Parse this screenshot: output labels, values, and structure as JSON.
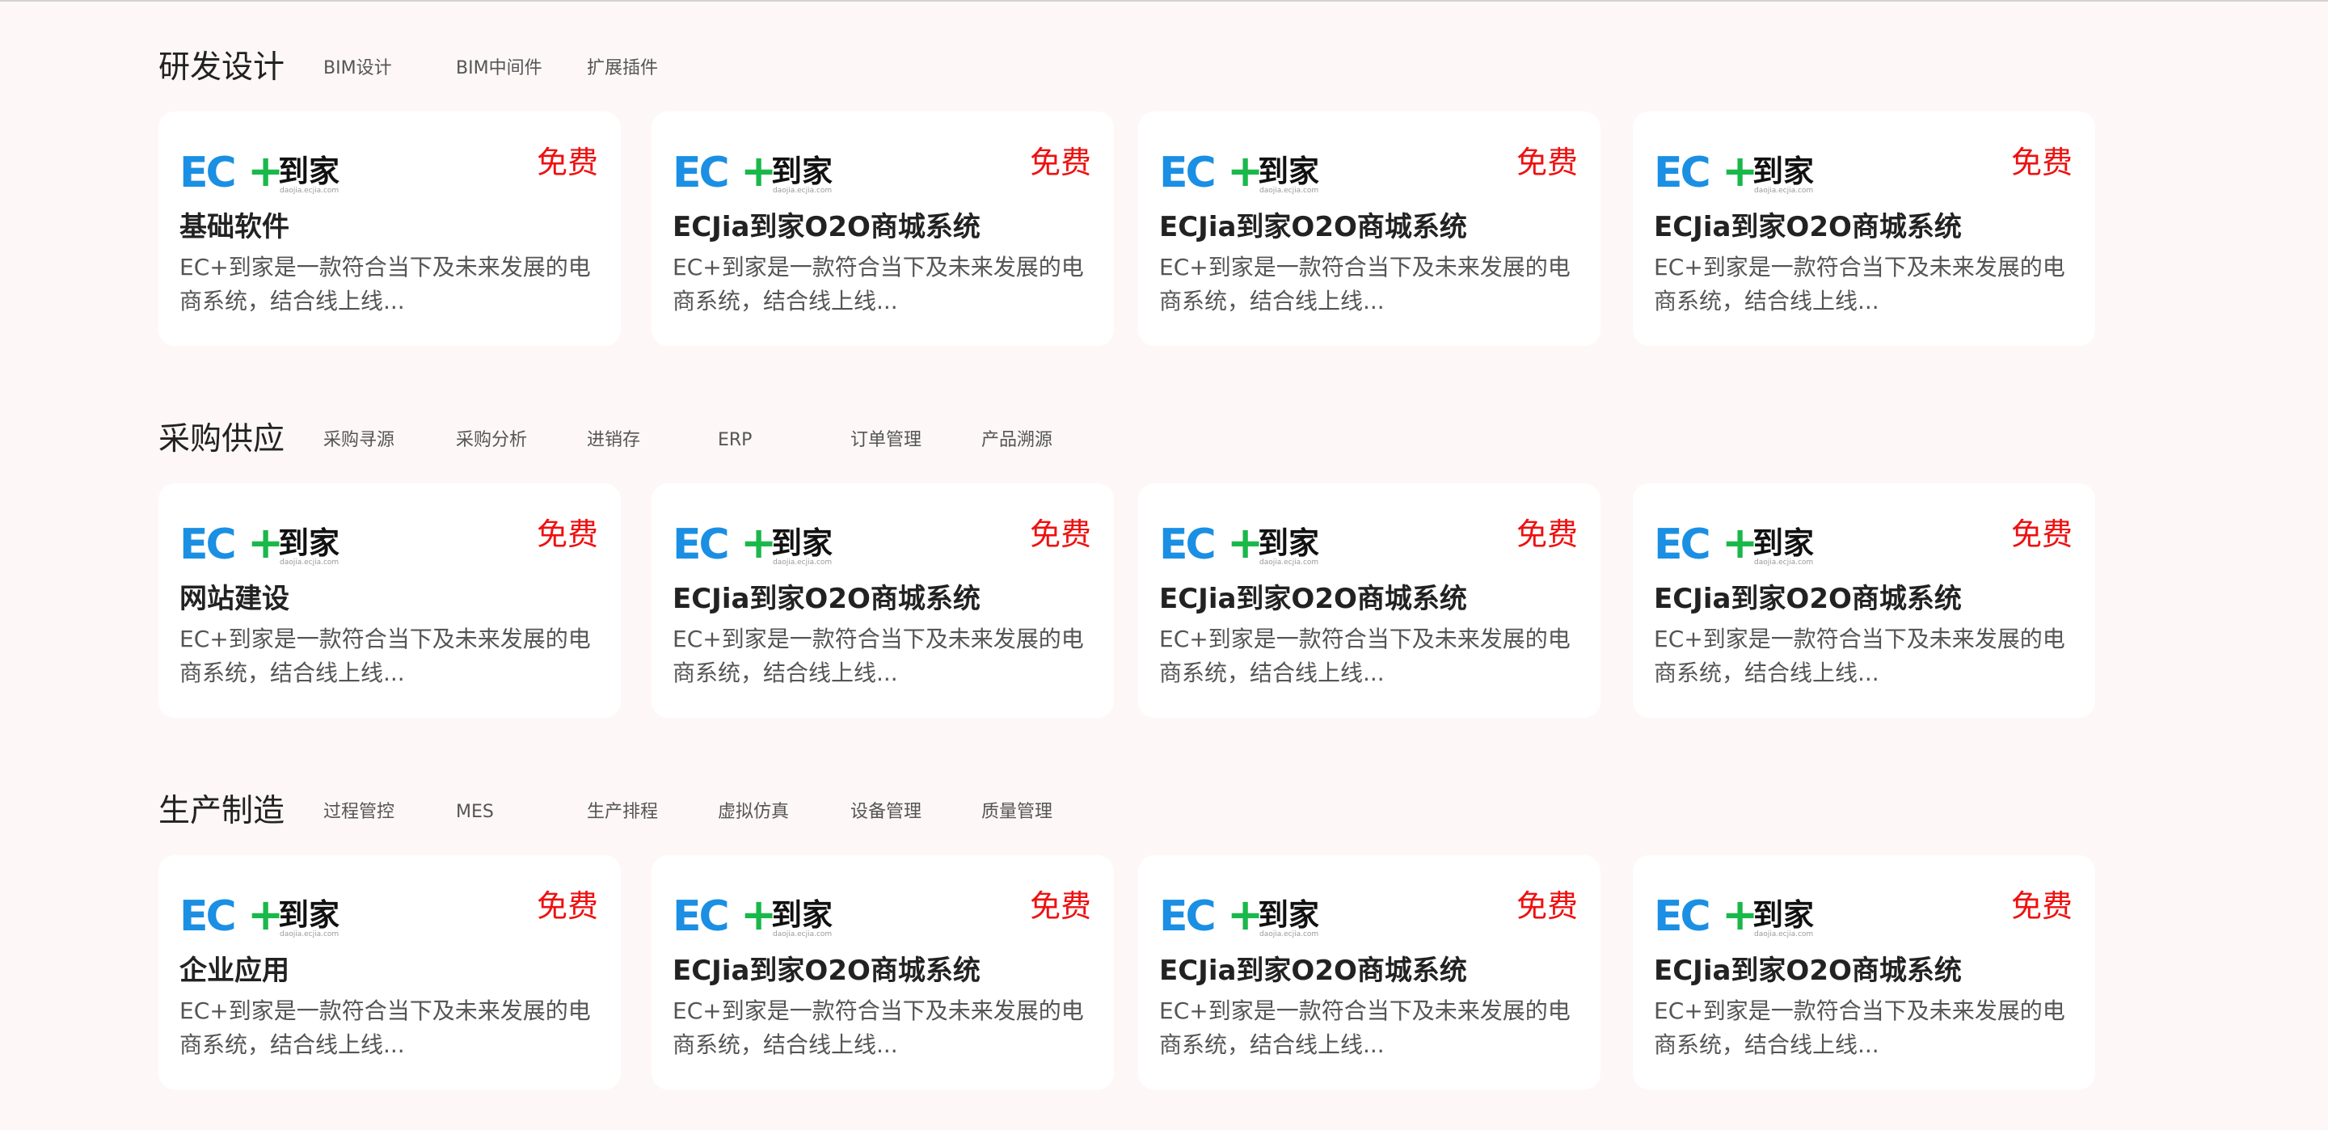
{
  "colors": {
    "page_background": "#fdf7f7",
    "card_background": "#ffffff",
    "badge_red": "#ee1111",
    "logo_blue": "#1a8fe3",
    "logo_green": "#1ab84a"
  },
  "logo": {
    "ec": "EC",
    "plus": "+",
    "cn": "到家",
    "url": "daojia.ecjia.com"
  },
  "sections": [
    {
      "title": "研发设计",
      "tags": [
        "BIM设计",
        "BIM中间件",
        "扩展插件"
      ],
      "cards": [
        {
          "badge": "免费",
          "title": "基础软件",
          "desc": "EC+到家是一款符合当下及未来发展的电商系统，结合线上线..."
        },
        {
          "badge": "免费",
          "title": "ECJia到家O2O商城系统",
          "desc": "EC+到家是一款符合当下及未来发展的电商系统，结合线上线..."
        },
        {
          "badge": "免费",
          "title": "ECJia到家O2O商城系统",
          "desc": "EC+到家是一款符合当下及未来发展的电商系统，结合线上线..."
        },
        {
          "badge": "免费",
          "title": "ECJia到家O2O商城系统",
          "desc": "EC+到家是一款符合当下及未来发展的电商系统，结合线上线..."
        }
      ]
    },
    {
      "title": "采购供应",
      "tags": [
        "采购寻源",
        "采购分析",
        "进销存",
        "ERP",
        "订单管理",
        "产品溯源"
      ],
      "cards": [
        {
          "badge": "免费",
          "title": "网站建设",
          "desc": "EC+到家是一款符合当下及未来发展的电商系统，结合线上线..."
        },
        {
          "badge": "免费",
          "title": "ECJia到家O2O商城系统",
          "desc": "EC+到家是一款符合当下及未来发展的电商系统，结合线上线..."
        },
        {
          "badge": "免费",
          "title": "ECJia到家O2O商城系统",
          "desc": "EC+到家是一款符合当下及未来发展的电商系统，结合线上线..."
        },
        {
          "badge": "免费",
          "title": "ECJia到家O2O商城系统",
          "desc": "EC+到家是一款符合当下及未来发展的电商系统，结合线上线..."
        }
      ]
    },
    {
      "title": "生产制造",
      "tags": [
        "过程管控",
        "MES",
        "生产排程",
        "虚拟仿真",
        "设备管理",
        "质量管理"
      ],
      "cards": [
        {
          "badge": "免费",
          "title": "企业应用",
          "desc": "EC+到家是一款符合当下及未来发展的电商系统，结合线上线..."
        },
        {
          "badge": "免费",
          "title": "ECJia到家O2O商城系统",
          "desc": "EC+到家是一款符合当下及未来发展的电商系统，结合线上线..."
        },
        {
          "badge": "免费",
          "title": "ECJia到家O2O商城系统",
          "desc": "EC+到家是一款符合当下及未来发展的电商系统，结合线上线..."
        },
        {
          "badge": "免费",
          "title": "ECJia到家O2O商城系统",
          "desc": "EC+到家是一款符合当下及未来发展的电商系统，结合线上线..."
        }
      ]
    }
  ]
}
